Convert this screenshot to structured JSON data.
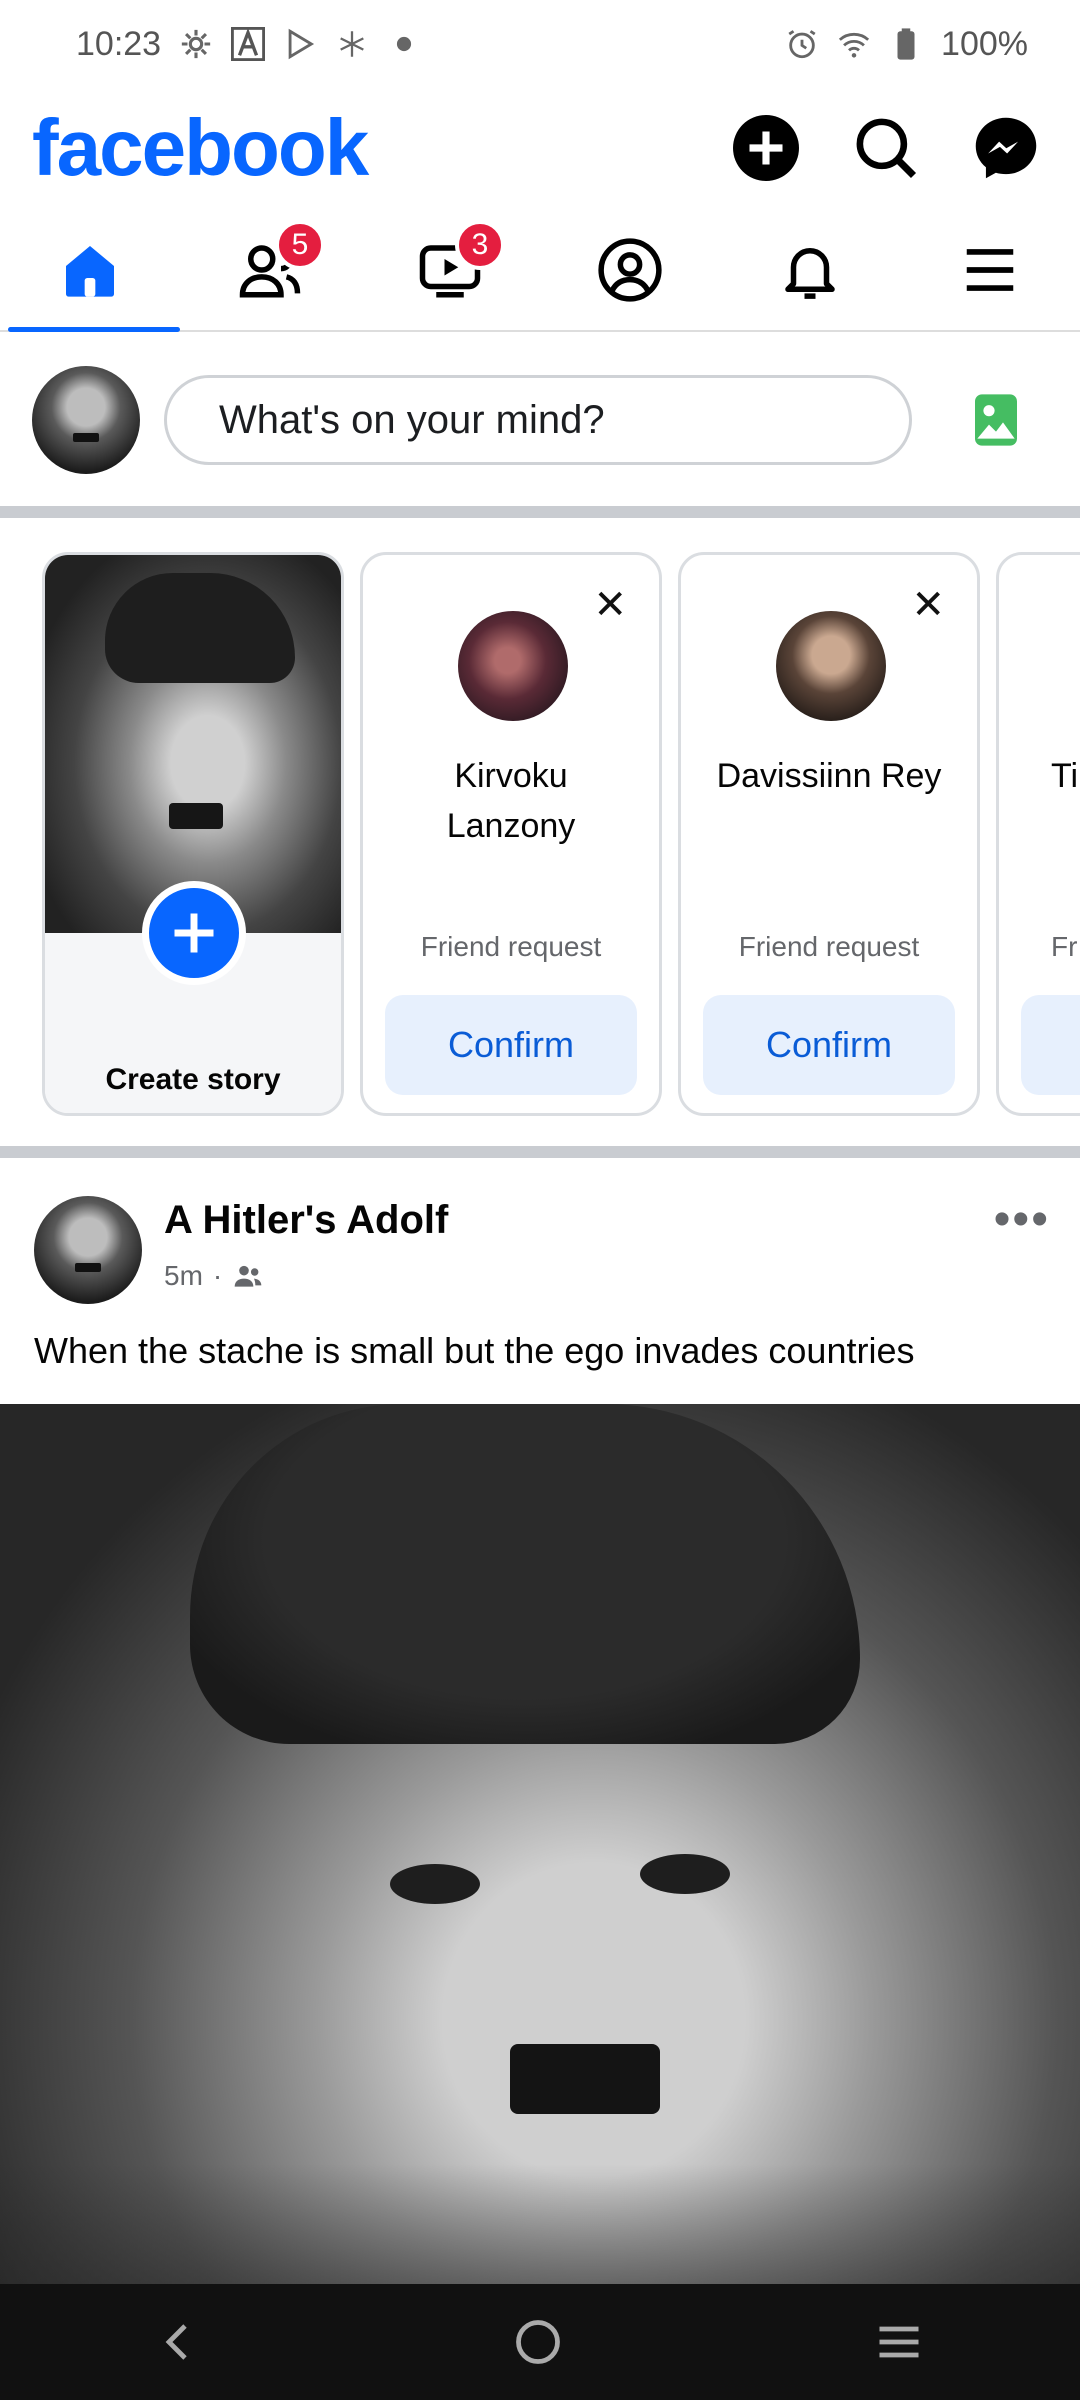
{
  "status_bar": {
    "time": "10:23",
    "battery": "100%"
  },
  "header": {
    "logo": "facebook"
  },
  "tabs": {
    "friends_badge": "5",
    "video_badge": "3"
  },
  "composer": {
    "placeholder": "What's on your mind?"
  },
  "stories": {
    "create_label": "Create story",
    "requests": [
      {
        "name_line1": "Kirvoku",
        "name_line2": "Lanzony",
        "subtitle": "Friend request",
        "action": "Confirm"
      },
      {
        "name_line1": "Davissiinn Rey",
        "name_line2": "",
        "subtitle": "Friend request",
        "action": "Confirm"
      },
      {
        "name_line1": "Ti",
        "name_line2": "",
        "subtitle": "Fr",
        "action": ""
      }
    ]
  },
  "post": {
    "author": "A Hitler's Adolf",
    "time": "5m",
    "dot": "·",
    "text": "When the stache is small but the ego invades countries"
  },
  "colors": {
    "brand": "#0866ff",
    "badge": "#e41e3f",
    "confirm_bg": "#e7f0fd"
  }
}
